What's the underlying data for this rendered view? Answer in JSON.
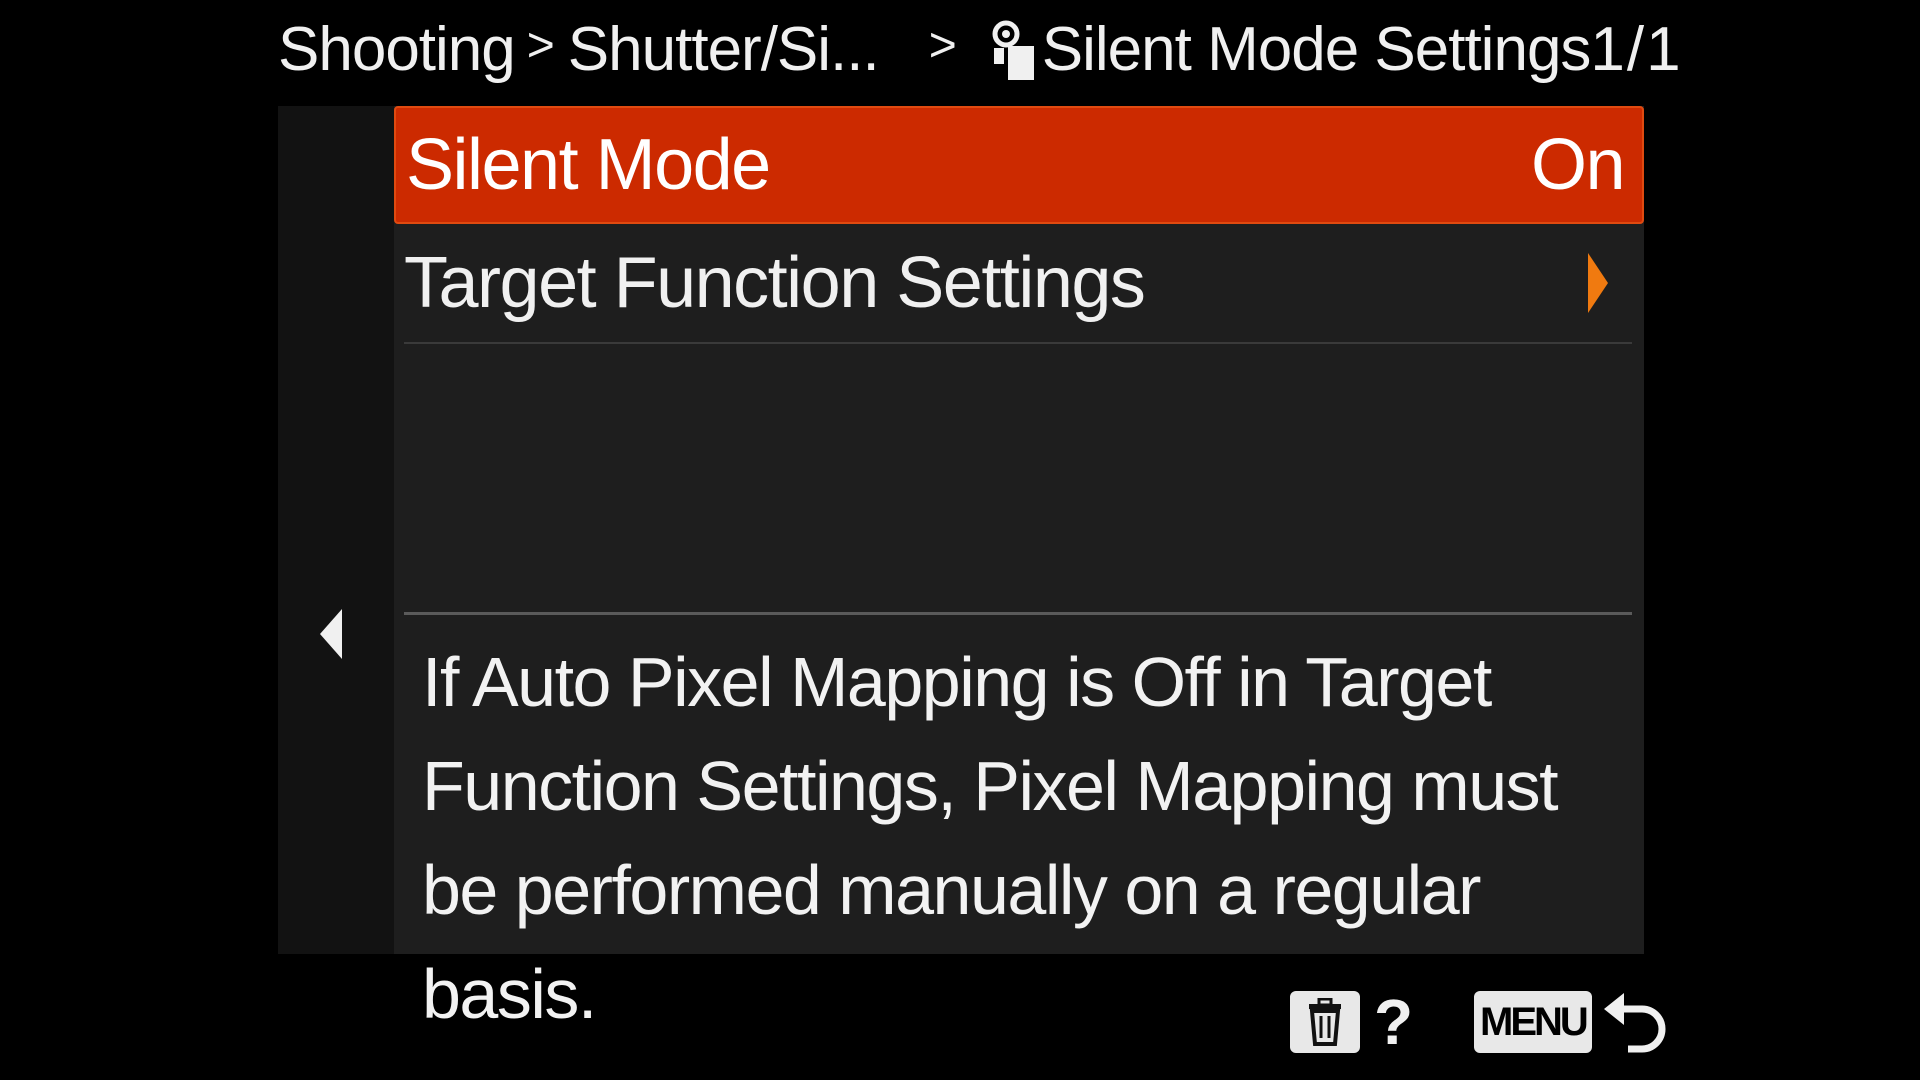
{
  "header": {
    "crumb1": "Shooting",
    "crumb2": "Shutter/Si...",
    "title": "Silent Mode Settings",
    "page": "1/1",
    "separator1": ">",
    "separator2": ">"
  },
  "menu": {
    "items": [
      {
        "label": "Silent Mode",
        "value": "On"
      },
      {
        "label": "Target Function Settings",
        "value": ""
      }
    ]
  },
  "help": {
    "text": "If Auto Pixel Mapping is Off in Target Function Settings, Pixel Mapping must be performed manually on a regular basis."
  },
  "footer": {
    "help_glyph": "?",
    "menu_label": "MENU"
  },
  "icons": {
    "header": "silent-mode-icon",
    "left": "left-arrow-icon",
    "submenu": "submenu-arrow-icon",
    "delete": "trash-icon",
    "back": "return-icon"
  },
  "colors": {
    "selected_row": "#cc2a00",
    "accent_arrow": "#f07a10",
    "panel": "#1e1e1e"
  }
}
